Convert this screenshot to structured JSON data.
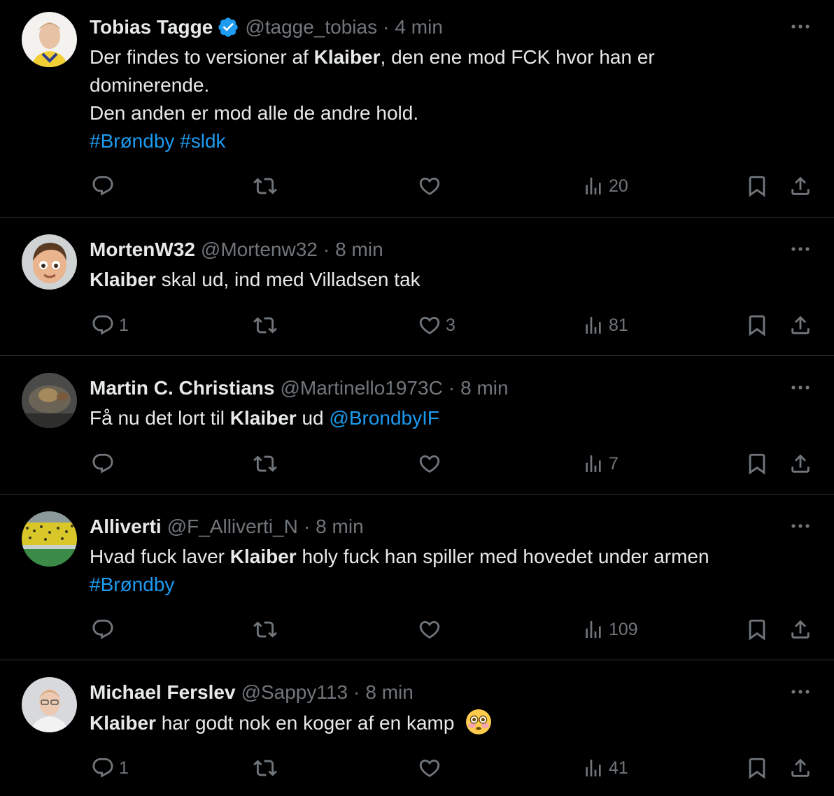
{
  "colors": {
    "background": "#000000",
    "text": "#e7e9ea",
    "muted": "#71767b",
    "link": "#1d9bf0",
    "divider": "#2f3336",
    "verified": "#1d9bf0"
  },
  "icons": {
    "reply": "reply-icon",
    "repost": "repost-icon",
    "like": "heart-icon",
    "views": "analytics-icon",
    "bookmark": "bookmark-icon",
    "share": "share-icon",
    "more": "more-icon",
    "verified": "verified-badge-icon"
  },
  "tweets": [
    {
      "display_name": "Tobias Tagge",
      "verified": true,
      "handle": "@tagge_tobias",
      "separator": "·",
      "time": "4 min",
      "text": {
        "l1_a": "Der findes to versioner af ",
        "l1_b": "Klaiber",
        "l1_c": ", den ene mod FCK hvor han er",
        "l2": "dominerende.",
        "l3": "Den anden er mod alle de andre hold.",
        "tag1": "#Brøndby",
        "tag2": "#sldk"
      },
      "stats": {
        "replies": "",
        "reposts": "",
        "likes": "",
        "views": "20"
      }
    },
    {
      "display_name": "MortenW32",
      "verified": false,
      "handle": "@Mortenw32",
      "separator": "·",
      "time": "8 min",
      "text": {
        "bold": "Klaiber",
        "rest": " skal ud, ind med Villadsen tak"
      },
      "stats": {
        "replies": "1",
        "reposts": "",
        "likes": "3",
        "views": "81"
      }
    },
    {
      "display_name": "Martin C. Christians",
      "verified": false,
      "handle": "@Martinello1973C",
      "separator": "·",
      "time": "8 min",
      "text": {
        "a": "Få nu det lort til ",
        "bold": "Klaiber",
        "b": " ud ",
        "mention": "@BrondbyIF"
      },
      "stats": {
        "replies": "",
        "reposts": "",
        "likes": "",
        "views": "7"
      }
    },
    {
      "display_name": "Alliverti",
      "verified": false,
      "handle": "@F_Alliverti_N",
      "separator": "·",
      "time": "8 min",
      "text": {
        "a": "Hvad fuck laver ",
        "bold": "Klaiber",
        "b": " holy fuck han spiller med hovedet under armen",
        "tag": "#Brøndby"
      },
      "stats": {
        "replies": "",
        "reposts": "",
        "likes": "",
        "views": "109"
      }
    },
    {
      "display_name": "Michael Ferslev",
      "verified": false,
      "handle": "@Sappy113",
      "separator": "·",
      "time": "8 min",
      "text": {
        "bold": "Klaiber",
        "rest": " har godt nok en koger af en kamp",
        "emoji": "flushed-face-emoji"
      },
      "stats": {
        "replies": "1",
        "reposts": "",
        "likes": "",
        "views": "41"
      }
    }
  ]
}
